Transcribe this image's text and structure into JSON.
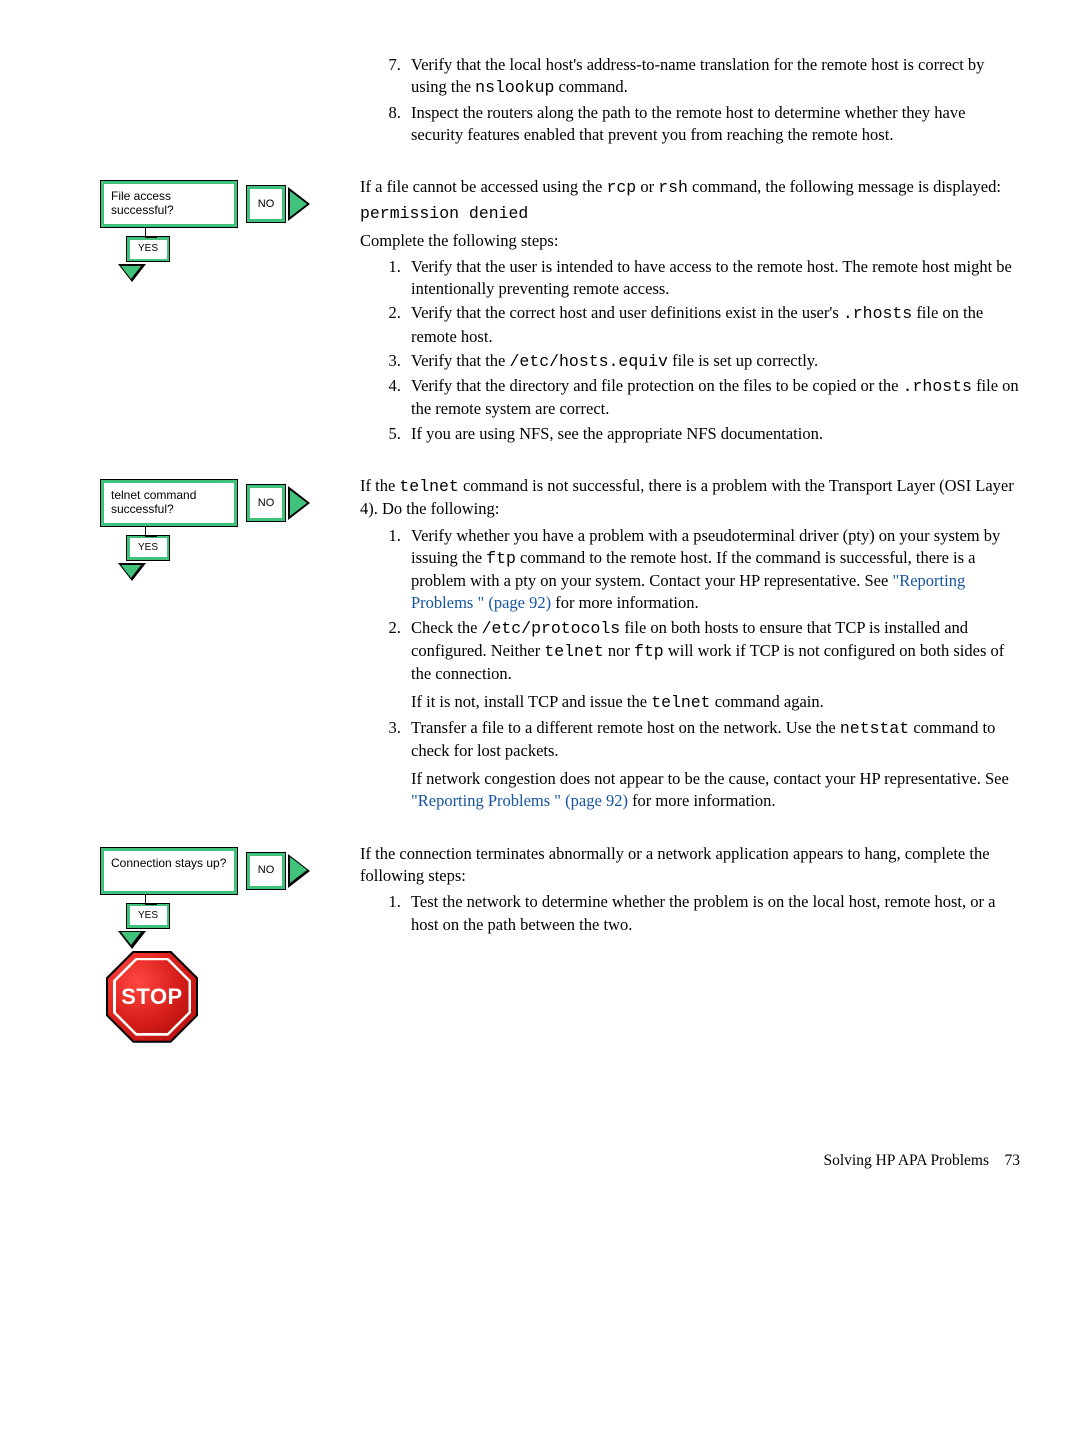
{
  "top_list": {
    "start": 7,
    "items": [
      {
        "pre": "Verify that the local host's address-to-name translation for the remote host is correct by using the ",
        "code": "nslookup",
        "post": " command."
      },
      {
        "pre": "Inspect the routers along the path to the remote host to determine whether they have security features enabled that prevent you from reaching the remote host."
      }
    ]
  },
  "file_access": {
    "question": "File access successful?",
    "no": "NO",
    "yes": "YES",
    "intro1a": "If a file cannot be accessed using the ",
    "intro1_c1": "rcp",
    "intro1_mid": " or ",
    "intro1_c2": "rsh",
    "intro1b": " command, the following message is displayed:",
    "msg": "permission denied",
    "intro2": "Complete the following steps:",
    "items": [
      {
        "t": "Verify that the user is intended to have access to the remote host. The remote host might be intentionally preventing remote access."
      },
      {
        "pre": "Verify that the correct host and user definitions exist in the user's ",
        "code": ".rhosts",
        "post": " file on the remote host."
      },
      {
        "pre": "Verify that the ",
        "code": "/etc/hosts.equiv",
        "post": " file is set up correctly."
      },
      {
        "pre": "Verify that the directory and file protection on the files to be copied or the ",
        "code": ".rhosts",
        "post": " file on the remote system are correct."
      },
      {
        "t": "If you are using NFS, see the appropriate NFS documentation."
      }
    ]
  },
  "telnet": {
    "question": "telnet command successful?",
    "no": "NO",
    "yes": "YES",
    "intro_pre": "If the ",
    "intro_c": "telnet",
    "intro_post": " command is not successful, there is a problem with the Transport Layer (OSI Layer 4). Do the following:",
    "item1_pre": "Verify whether you have a problem with a pseudoterminal driver (pty) on your system by issuing the ",
    "item1_c": "ftp",
    "item1_mid": " command to the remote host. If the command is successful, there is a problem with a pty on your system. Contact your HP representative. See ",
    "item1_link": "\"Reporting Problems \" (page 92)",
    "item1_post": " for more information.",
    "item2_pre": "Check the ",
    "item2_c1": "/etc/protocols",
    "item2_mid1": " file on both hosts to ensure that TCP is installed and configured. Neither ",
    "item2_c2": "telnet",
    "item2_mid2": " nor ",
    "item2_c3": "ftp",
    "item2_post": " will work if TCP is not configured on both sides of the connection.",
    "item2_para_pre": "If it is not, install TCP and issue the ",
    "item2_para_c": "telnet",
    "item2_para_post": " command again.",
    "item3_pre": "Transfer a file to a different remote host on the network. Use the ",
    "item3_c": "netstat",
    "item3_post": " command to check for lost packets.",
    "item3_para_pre": "If network congestion does not appear to be the cause, contact your HP representative. See ",
    "item3_link": "\"Reporting Problems \" (page 92)",
    "item3_para_post": " for more information."
  },
  "connection": {
    "question": "Connection stays up?",
    "no": "NO",
    "yes": "YES",
    "intro": "If the connection terminates abnormally or a network application appears to hang, complete the following steps:",
    "item1": "Test the network to determine whether the problem is on the local host, remote host, or a host on the path between the two.",
    "stop": "STOP"
  },
  "footer": {
    "title": "Solving HP APA Problems",
    "page": "73"
  }
}
